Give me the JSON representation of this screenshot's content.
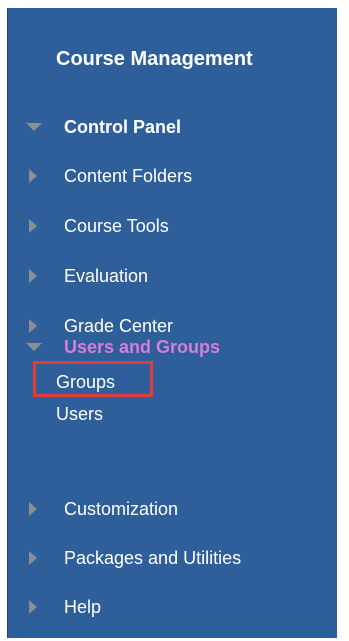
{
  "panel": {
    "title": "Course Management",
    "control_panel": {
      "label": "Control Panel",
      "expanded": true
    },
    "items": [
      {
        "label": "Content Folders",
        "expanded": false
      },
      {
        "label": "Course Tools",
        "expanded": false
      },
      {
        "label": "Evaluation",
        "expanded": false
      },
      {
        "label": "Grade Center",
        "expanded": false
      }
    ],
    "users_and_groups": {
      "label": "Users and Groups",
      "expanded": true,
      "children": [
        {
          "label": "Groups",
          "highlighted": true
        },
        {
          "label": "Users",
          "highlighted": false
        }
      ]
    },
    "items_after": [
      {
        "label": "Customization",
        "expanded": false
      },
      {
        "label": "Packages and Utilities",
        "expanded": false
      },
      {
        "label": "Help",
        "expanded": false
      }
    ]
  },
  "colors": {
    "panel_bg": "#2e5f9a",
    "text": "#ffffff",
    "active_section": "#d77cdc",
    "arrow": "#8a8f96",
    "highlight_box": "#e63b3b"
  },
  "icons": {
    "collapsed": "triangle-right-icon",
    "expanded": "triangle-down-icon"
  }
}
